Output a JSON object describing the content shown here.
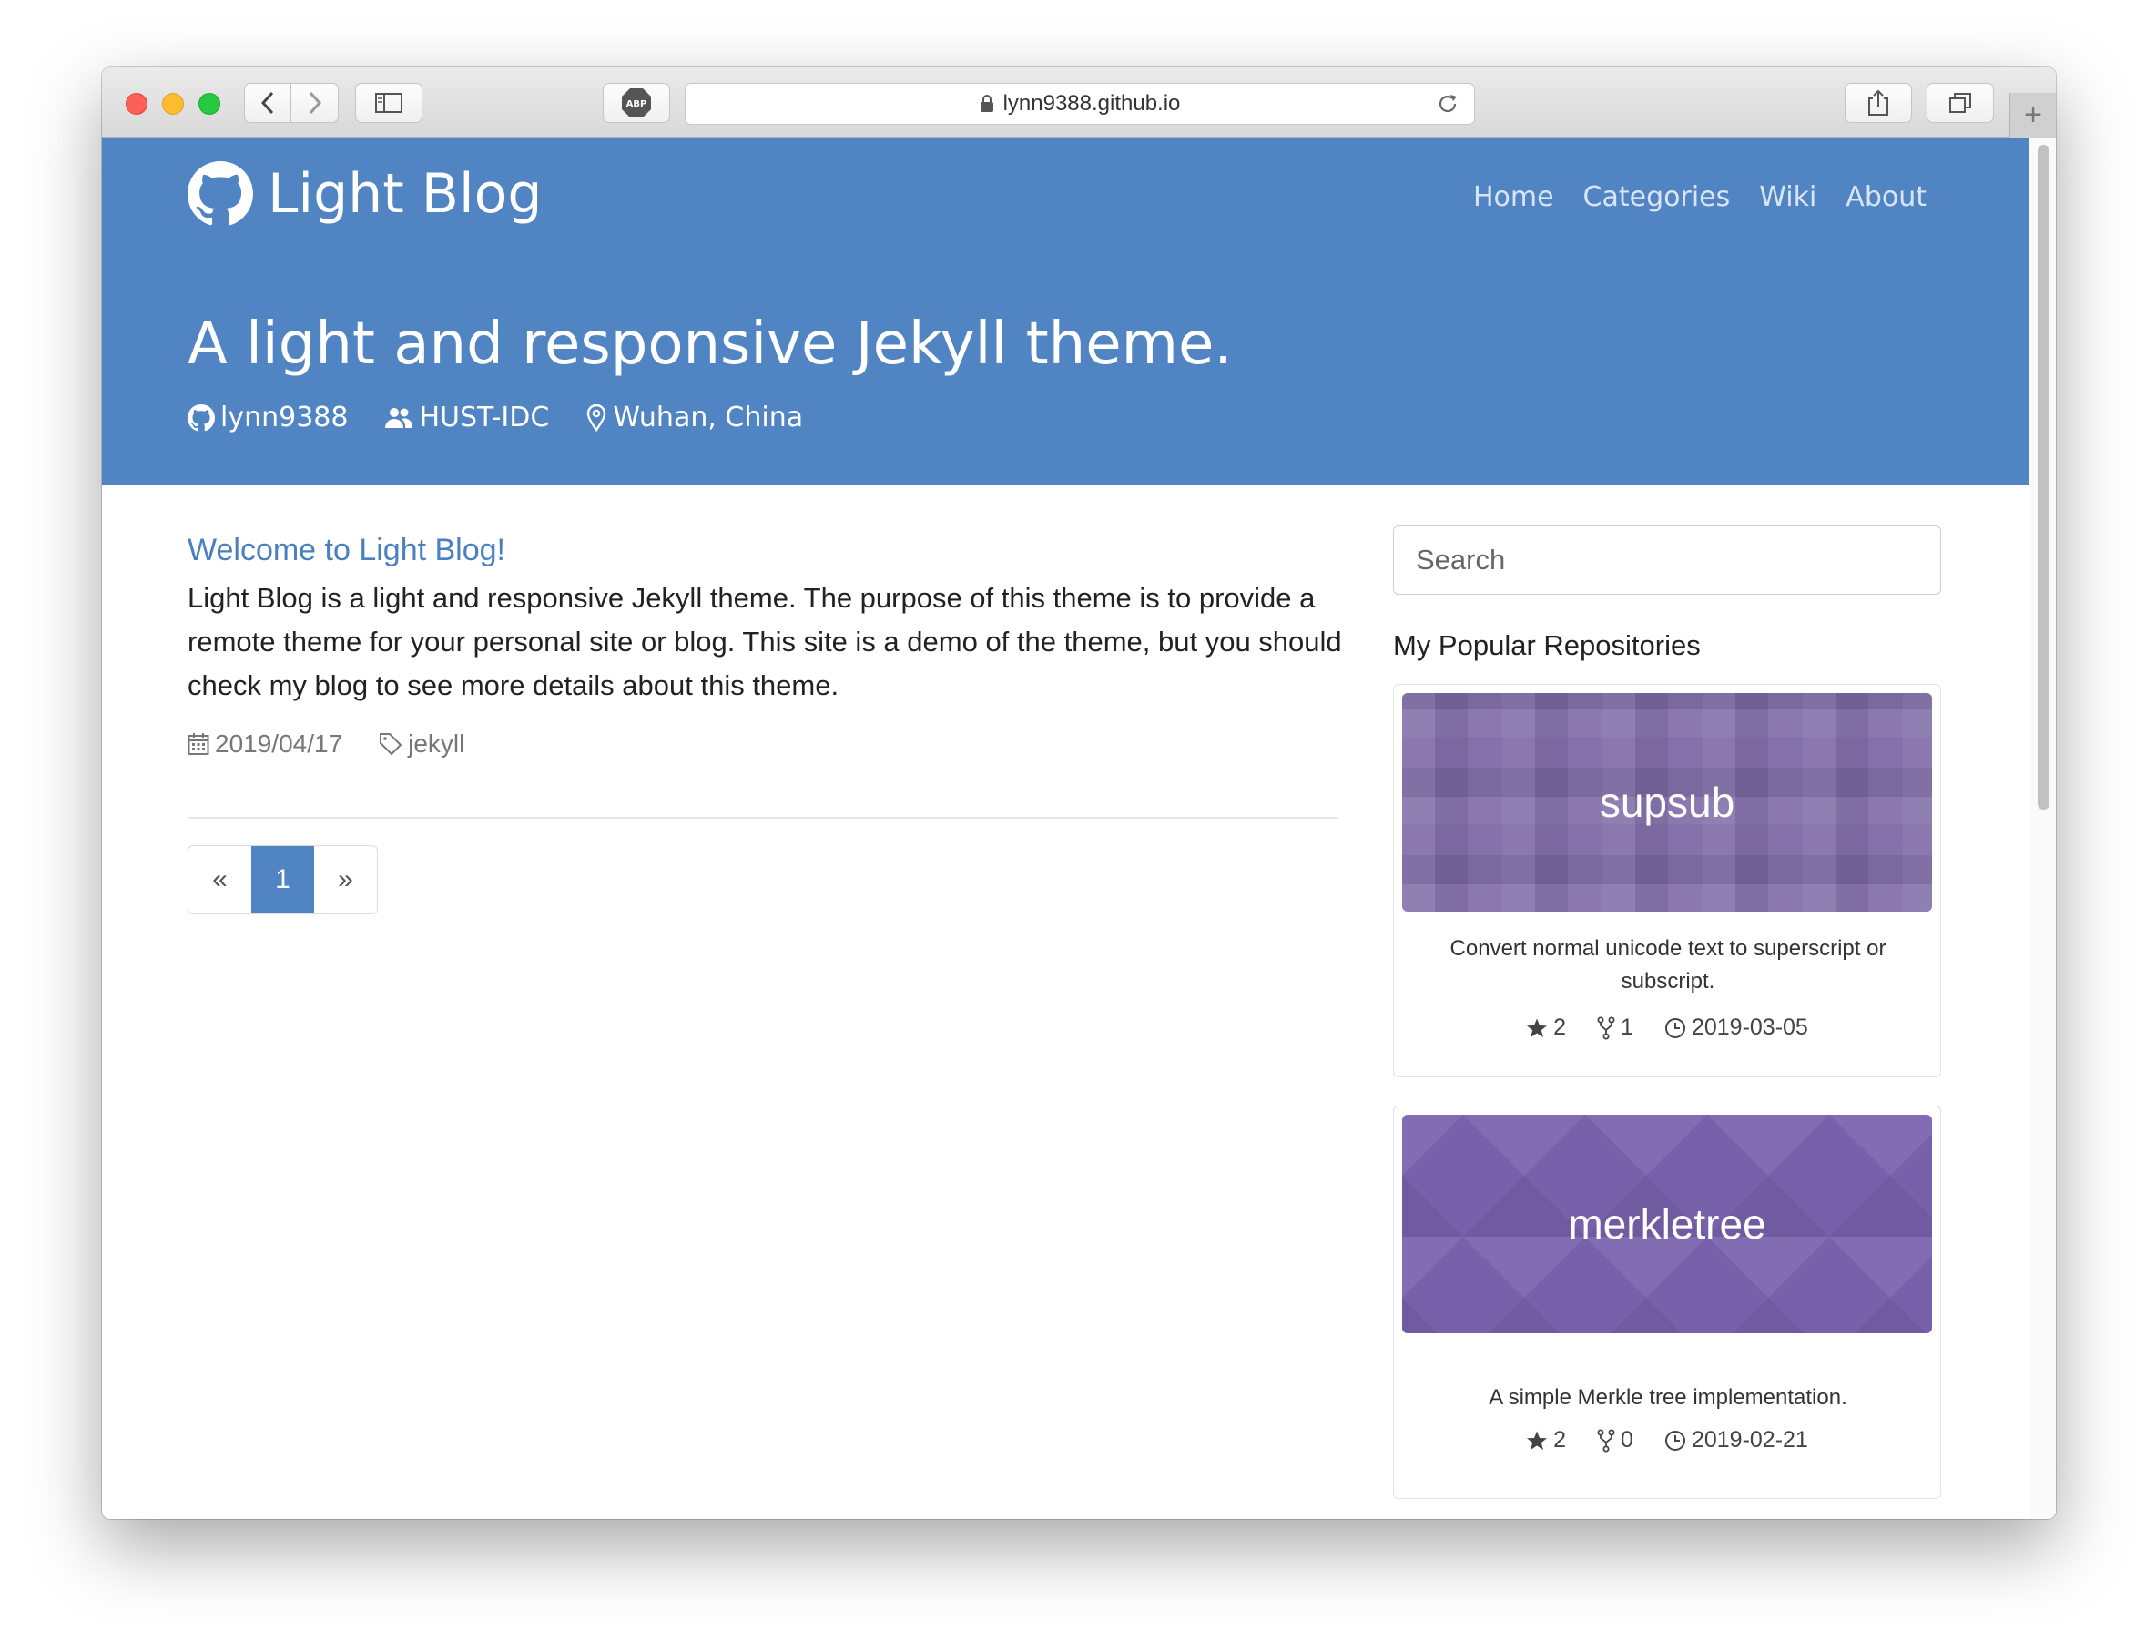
{
  "browser": {
    "url": "lynn9388.github.io",
    "abp_label": "ABP"
  },
  "site": {
    "brand": "Light Blog",
    "nav": [
      "Home",
      "Categories",
      "Wiki",
      "About"
    ],
    "tagline": "A light and responsive Jekyll theme.",
    "meta": {
      "github": "lynn9388",
      "org": "HUST-IDC",
      "location": "Wuhan, China"
    },
    "header_color": "#5084c2"
  },
  "post": {
    "title": "Welcome to Light Blog!",
    "body": "Light Blog is a light and responsive Jekyll theme. The purpose of this theme is to provide a remote theme for your personal site or blog. This site is a demo of the theme, but you should check my blog to see more details about this theme.",
    "date": "2019/04/17",
    "tag": "jekyll"
  },
  "pagination": {
    "prev": "«",
    "current": "1",
    "next": "»"
  },
  "sidebar": {
    "search_placeholder": "Search",
    "repos_title": "My Popular Repositories",
    "repos": [
      {
        "name": "supsub",
        "description": "Convert normal unicode text to superscript or subscript.",
        "stars": "2",
        "forks": "1",
        "updated": "2019-03-05"
      },
      {
        "name": "merkletree",
        "description": "A simple Merkle tree implementation.",
        "stars": "2",
        "forks": "0",
        "updated": "2019-02-21"
      }
    ]
  }
}
